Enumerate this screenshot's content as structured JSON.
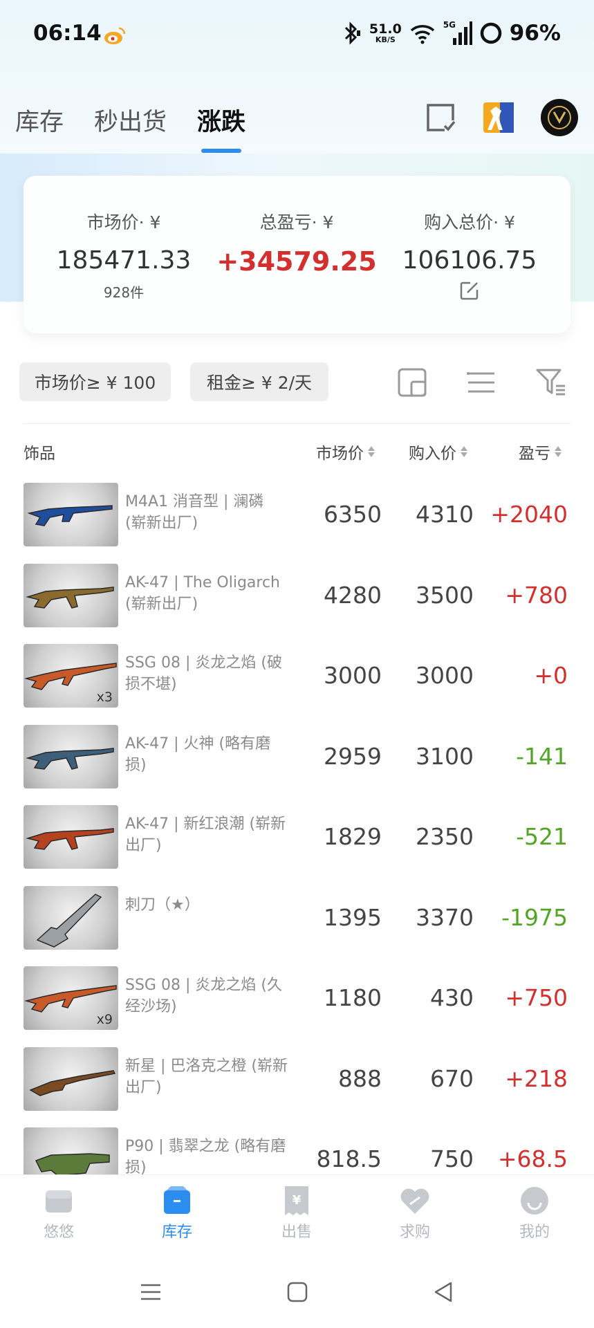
{
  "status_bar": {
    "time": "06:14",
    "net_speed": "51.0",
    "net_unit": "KB/S",
    "network": "5G",
    "battery": "96%"
  },
  "tabs": [
    {
      "label": "库存"
    },
    {
      "label": "秒出货"
    },
    {
      "label": "涨跌"
    }
  ],
  "active_tab": 2,
  "summary": {
    "market_label": "市场价· ¥",
    "market_value": "185471.33",
    "market_count": "928件",
    "profit_label": "总盈亏· ¥",
    "profit_value": "+34579.25",
    "cost_label": "购入总价· ¥",
    "cost_value": "106106.75"
  },
  "filters": {
    "market_chip": "市场价≥ ¥ 100",
    "rent_chip": "租金≥ ¥ 2/天"
  },
  "table": {
    "headers": {
      "item": "饰品",
      "market": "市场价",
      "buy": "购入价",
      "pl": "盈亏"
    },
    "rows": [
      {
        "name": "M4A1 消音型 | 澜磷 (崭新出厂)",
        "qty": "",
        "market": "6350",
        "buy": "4310",
        "pl": "+2040",
        "trend": "pos",
        "weapon": "rifle",
        "color": "#1f4e9c"
      },
      {
        "name": "AK-47 | The Oligarch (崭新出厂)",
        "qty": "",
        "market": "4280",
        "buy": "3500",
        "pl": "+780",
        "trend": "pos",
        "weapon": "ak",
        "color": "#8a6a2e"
      },
      {
        "name": "SSG 08 | 炎龙之焰 (破损不堪)",
        "qty": "x3",
        "market": "3000",
        "buy": "3000",
        "pl": "+0",
        "trend": "pos",
        "weapon": "sniper",
        "color": "#c85a2a"
      },
      {
        "name": "AK-47 | 火神 (略有磨损)",
        "qty": "",
        "market": "2959",
        "buy": "3100",
        "pl": "-141",
        "trend": "neg",
        "weapon": "ak",
        "color": "#3d5f7a"
      },
      {
        "name": "AK-47 | 新红浪潮 (崭新出厂)",
        "qty": "",
        "market": "1829",
        "buy": "2350",
        "pl": "-521",
        "trend": "neg",
        "weapon": "ak",
        "color": "#b4421e"
      },
      {
        "name": "刺刀（★）",
        "qty": "",
        "market": "1395",
        "buy": "3370",
        "pl": "-1975",
        "trend": "neg",
        "weapon": "knife",
        "color": "#9aa0a4"
      },
      {
        "name": "SSG 08 | 炎龙之焰 (久经沙场)",
        "qty": "x9",
        "market": "1180",
        "buy": "430",
        "pl": "+750",
        "trend": "pos",
        "weapon": "sniper",
        "color": "#c85a2a"
      },
      {
        "name": "新星 | 巴洛克之橙 (崭新出厂)",
        "qty": "",
        "market": "888",
        "buy": "670",
        "pl": "+218",
        "trend": "pos",
        "weapon": "shotgun",
        "color": "#7a4a22"
      },
      {
        "name": "P90 | 翡翠之龙 (略有磨损)",
        "qty": "",
        "market": "818.5",
        "buy": "750",
        "pl": "+68.5",
        "trend": "pos",
        "weapon": "smg",
        "color": "#5c7a3a"
      }
    ]
  },
  "bottom_nav": [
    {
      "label": "悠悠"
    },
    {
      "label": "库存"
    },
    {
      "label": "出售"
    },
    {
      "label": "求购"
    },
    {
      "label": "我的"
    }
  ],
  "colors": {
    "accent": "#2b8df0",
    "profit": "#d32f2f",
    "loss": "#52a424"
  }
}
